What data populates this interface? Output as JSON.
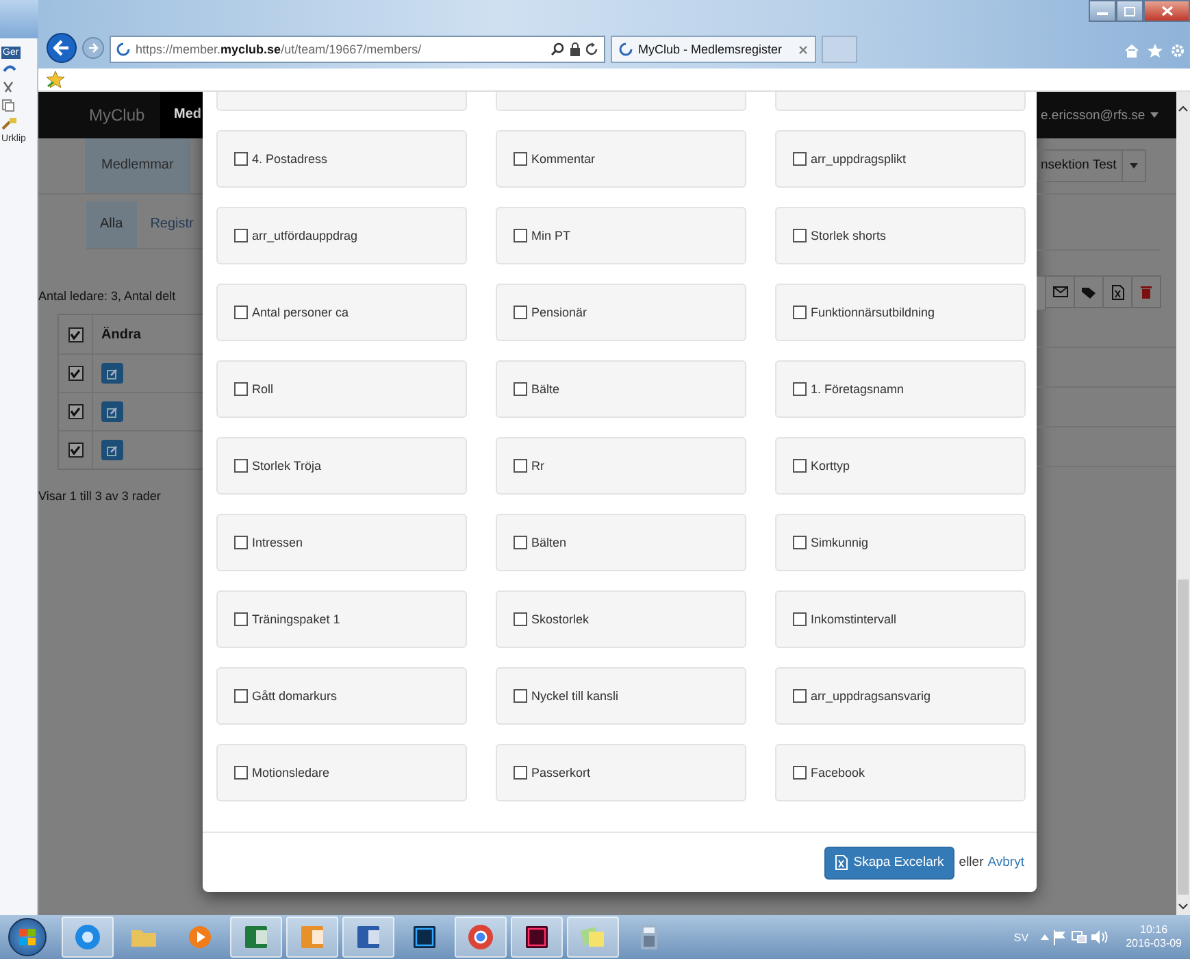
{
  "desktop": {
    "texts": [
      "Ger",
      "Urklip"
    ]
  },
  "browser": {
    "url": "https://member.**myclub.se**/ut/team/19667/members/",
    "tab_title": "MyClub - Medlemsregister"
  },
  "page": {
    "brand": "MyClub",
    "nav_item": "Med",
    "user": "e.ericsson@rfs.se",
    "subnav": [
      {
        "label": "Medlemmar",
        "selected": true
      }
    ],
    "section_select": "nsektion Test",
    "pills": [
      {
        "label": "Alla",
        "selected": true
      },
      {
        "label": "Registr",
        "selected": false
      }
    ],
    "summary": "Antal ledare: 3, Antal delt",
    "table": {
      "header": {
        "checked": true,
        "label": "Ändra"
      },
      "rows": [
        {
          "checked": true
        },
        {
          "checked": true
        },
        {
          "checked": true
        }
      ]
    },
    "footer": "Visar 1 till 3 av 3 rader",
    "toolbar": [
      {
        "kind": "mail"
      },
      {
        "kind": "tag"
      },
      {
        "kind": "excel"
      },
      {
        "kind": "delete"
      }
    ]
  },
  "modal": {
    "fields": [
      {
        "label": "4. Postadress",
        "checked": false
      },
      {
        "label": "Kommentar",
        "checked": false
      },
      {
        "label": "arr_uppdragsplikt",
        "checked": false
      },
      {
        "label": "arr_utfördauppdrag",
        "checked": false
      },
      {
        "label": "Min PT",
        "checked": false
      },
      {
        "label": "Storlek shorts",
        "checked": false
      },
      {
        "label": "Antal personer ca",
        "checked": false
      },
      {
        "label": "Pensionär",
        "checked": false
      },
      {
        "label": "Funktionnärsutbildning",
        "checked": false
      },
      {
        "label": "Roll",
        "checked": false
      },
      {
        "label": "Bälte",
        "checked": false
      },
      {
        "label": "1. Företagsnamn",
        "checked": false
      },
      {
        "label": "Storlek Tröja",
        "checked": false
      },
      {
        "label": "Rr",
        "checked": false
      },
      {
        "label": "Korttyp",
        "checked": false
      },
      {
        "label": "Intressen",
        "checked": false
      },
      {
        "label": "Bälten",
        "checked": false
      },
      {
        "label": "Simkunnig",
        "checked": false
      },
      {
        "label": "Träningspaket 1",
        "checked": false
      },
      {
        "label": "Skostorlek",
        "checked": false
      },
      {
        "label": "Inkomstintervall",
        "checked": false
      },
      {
        "label": "Gått domarkurs",
        "checked": false
      },
      {
        "label": "Nyckel till kansli",
        "checked": false
      },
      {
        "label": "arr_uppdragsansvarig",
        "checked": false
      },
      {
        "label": "Motionsledare",
        "checked": false
      },
      {
        "label": "Passerkort",
        "checked": false
      },
      {
        "label": "Facebook",
        "checked": false
      }
    ],
    "submit": "Skapa Excelark",
    "separator": "eller",
    "cancel": "Avbryt"
  },
  "taskbar": {
    "apps": [
      {
        "kind": "ie",
        "running": true
      },
      {
        "kind": "folder",
        "running": false
      },
      {
        "kind": "media",
        "running": false
      },
      {
        "kind": "excel",
        "running": true
      },
      {
        "kind": "outlook",
        "running": true
      },
      {
        "kind": "word",
        "running": true
      },
      {
        "kind": "photoshop",
        "running": false
      },
      {
        "kind": "chrome",
        "running": true
      },
      {
        "kind": "indesign",
        "running": true
      },
      {
        "kind": "notes",
        "running": true
      },
      {
        "kind": "calculator",
        "running": false
      }
    ],
    "language": "SV",
    "time": "10:16",
    "date": "2016-03-09"
  }
}
